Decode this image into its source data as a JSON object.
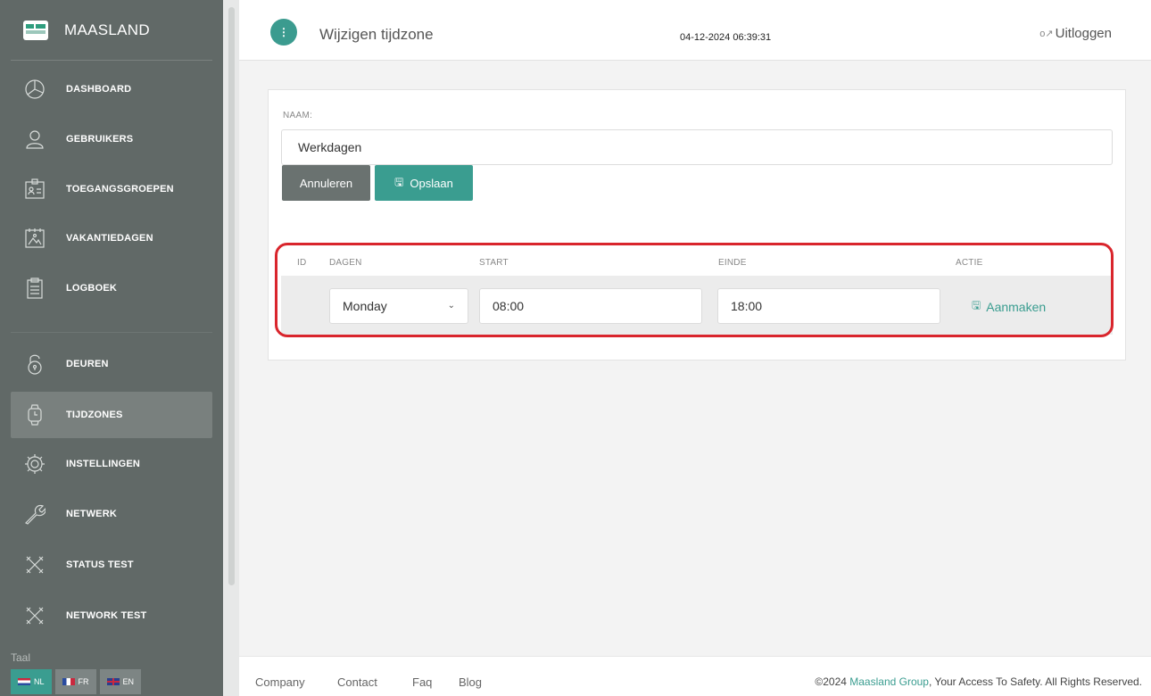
{
  "brand": {
    "name": "MAASLAND"
  },
  "sidebar": {
    "items": [
      {
        "label": "DASHBOARD",
        "icon": "chart-pie-icon"
      },
      {
        "label": "GEBRUIKERS",
        "icon": "user-icon"
      },
      {
        "label": "TOEGANGSGROEPEN",
        "icon": "badge-icon"
      },
      {
        "label": "VAKANTIEDAGEN",
        "icon": "calendar-icon"
      },
      {
        "label": "LOGBOEK",
        "icon": "clipboard-icon"
      },
      {
        "label": "DEUREN",
        "icon": "lock-icon"
      },
      {
        "label": "TIJDZONES",
        "icon": "watch-icon",
        "active": true
      },
      {
        "label": "INSTELLINGEN",
        "icon": "gear-icon"
      },
      {
        "label": "NETWERK",
        "icon": "wrench-icon"
      },
      {
        "label": "STATUS TEST",
        "icon": "tools-icon"
      },
      {
        "label": "NETWORK TEST",
        "icon": "tools-icon"
      }
    ],
    "taal_label": "Taal",
    "languages": [
      {
        "code": "NL",
        "active": true
      },
      {
        "code": "FR",
        "active": false
      },
      {
        "code": "EN",
        "active": false
      }
    ]
  },
  "header": {
    "title": "Wijzigen tijdzone",
    "datetime": "04-12-2024 06:39:31",
    "logout": "Uitloggen"
  },
  "form": {
    "naam_label": "NAAM:",
    "naam_value": "Werkdagen",
    "cancel_label": "Annuleren",
    "save_label": "Opslaan"
  },
  "table": {
    "headers": [
      "ID",
      "DAGEN",
      "START",
      "EINDE",
      "ACTIE"
    ],
    "row": {
      "id": "",
      "day": "Monday",
      "start": "08:00",
      "end": "18:00",
      "action": "Aanmaken"
    }
  },
  "footer": {
    "links": [
      "Company",
      "Contact",
      "Faq",
      "Blog"
    ],
    "copyright_prefix": "©2024 ",
    "copyright_brand": "Maasland Group",
    "copyright_suffix": ", Your Access To Safety. All Rights Reserved."
  },
  "colors": {
    "sidebar": "#616967",
    "accent": "#3a9d90",
    "highlight": "#d9252c"
  }
}
